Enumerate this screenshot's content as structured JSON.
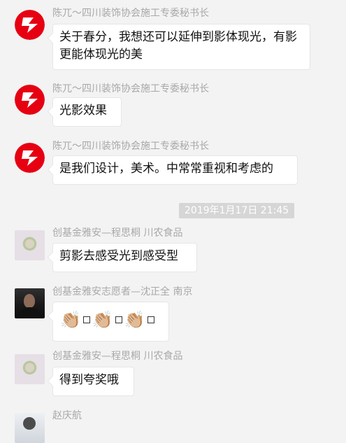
{
  "messages": [
    {
      "name": "陈兀～四川装饰协会施工专委秘书长",
      "text": "关于春分，我想还可以延伸到影体现光，有影更能体现光的美",
      "avatar": "logo"
    },
    {
      "name": "陈兀～四川装饰协会施工专委秘书长",
      "text": "光影效果",
      "avatar": "logo"
    },
    {
      "name": "陈兀～四川装饰协会施工专委秘书长",
      "text": "是我们设计，美术。中常常重视和考虑的",
      "avatar": "logo"
    },
    {
      "name": "创基金雅安—程思桐 川农食品",
      "text": "剪影去感受光到感受型",
      "avatar": "flower"
    },
    {
      "name": "创基金雅安志愿者—沈正全 南京",
      "text": "",
      "avatar": "man",
      "emoji": [
        "👏🏼",
        "□",
        "👏🏼",
        "□",
        "👏🏼",
        "□"
      ]
    },
    {
      "name": "创基金雅安—程思桐 川农食品",
      "text": "得到夸奖哦",
      "avatar": "flower"
    },
    {
      "name": "赵庆航",
      "text": "",
      "avatar": "person"
    }
  ],
  "timestamp": "2019年1月17日 21:45",
  "colors": {
    "background": "#f3f3f3",
    "bubble": "#ffffff",
    "name": "#a8a8a8",
    "logo_red": "#e60012"
  }
}
